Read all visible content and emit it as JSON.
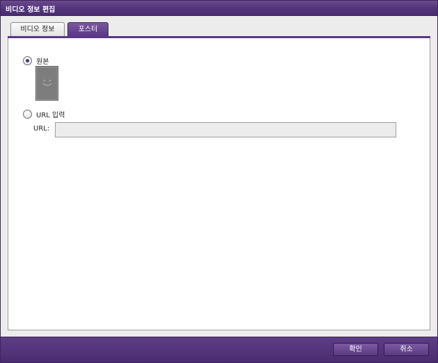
{
  "window": {
    "title": "비디오 정보 편집"
  },
  "tabs": [
    {
      "label": "비디오 정보",
      "active": false
    },
    {
      "label": "포스터",
      "active": true
    }
  ],
  "poster": {
    "options": [
      {
        "label": "원본",
        "selected": true
      },
      {
        "label": "URL 입력",
        "selected": false
      }
    ],
    "url_label": "URL:",
    "url_value": ""
  },
  "footer": {
    "ok_label": "확인",
    "cancel_label": "취소"
  },
  "colors": {
    "accent": "#5a3785",
    "titlebar": "#52337a",
    "content_bg": "#ececec"
  }
}
